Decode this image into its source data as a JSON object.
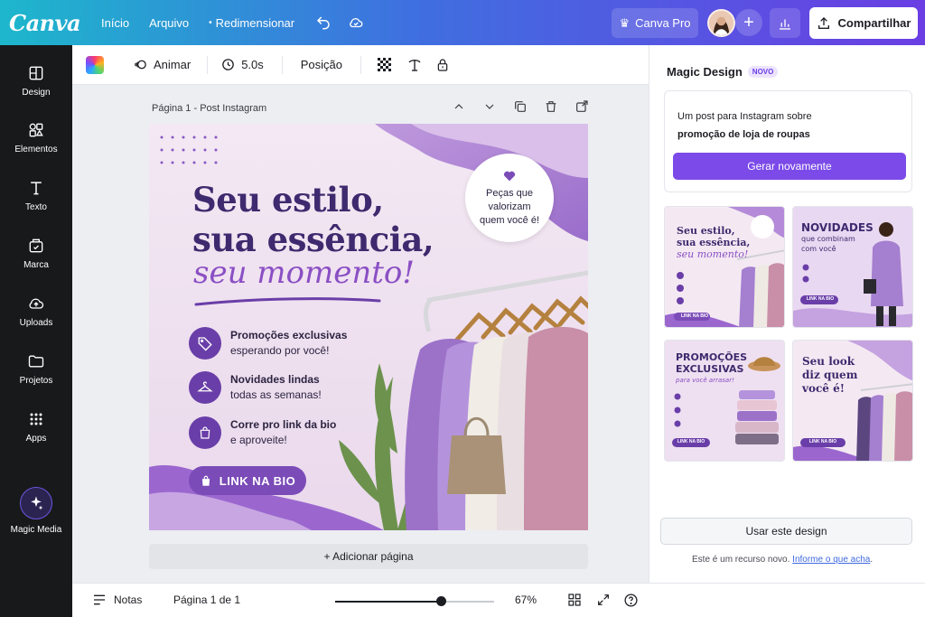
{
  "topbar": {
    "logo": "Canva",
    "nav": [
      "Início",
      "Arquivo"
    ],
    "resize": "Redimensionar",
    "pro": "Canva Pro",
    "share": "Compartilhar"
  },
  "sidebar": {
    "items": [
      "Design",
      "Elementos",
      "Texto",
      "Marca",
      "Uploads",
      "Projetos",
      "Apps"
    ],
    "magic": "Magic Media"
  },
  "toolbar": {
    "animate": "Animar",
    "duration": "5.0s",
    "position": "Posição"
  },
  "canvas": {
    "page_title": "Página 1 - Post Instagram",
    "add_page": "+ Adicionar página"
  },
  "design": {
    "headline_1": "Seu estilo,",
    "headline_2": "sua essência,",
    "script": "seu momento!",
    "bubble": [
      "Peças que",
      "valorizam",
      "quem você é!"
    ],
    "features": [
      {
        "title": "Promoções exclusivas",
        "sub": "esperando por você!"
      },
      {
        "title": "Novidades lindas",
        "sub": "todas as semanas!"
      },
      {
        "title": "Corre pro link da bio",
        "sub": "e aproveite!"
      }
    ],
    "cta": "LINK NA BIO"
  },
  "panel": {
    "title": "Magic Design",
    "badge": "NOVO",
    "prompt_1": "Um post para Instagram sobre",
    "prompt_2": "promoção de loja de roupas",
    "regenerate": "Gerar novamente",
    "thumbs": [
      {
        "line1": "Seu estilo,",
        "line2": "sua essência,",
        "line3": "seu momento!",
        "cta": "LINK NA BIO"
      },
      {
        "line1": "NOVIDADES",
        "line2": "que combinam",
        "line3": "com você",
        "cta": "LINK NA BIO"
      },
      {
        "line1": "PROMOÇÕES",
        "line2": "EXCLUSIVAS",
        "line3": "para você arrasar!",
        "cta": "LINK NA BIO"
      },
      {
        "line1": "Seu look",
        "line2": "diz quem",
        "line3": "você é!",
        "cta": "LINK NA BIO"
      }
    ],
    "use": "Usar este design",
    "feedback": "Este é um recurso novo.",
    "feedback_link": "Informe o que acha"
  },
  "bottom": {
    "notes": "Notas",
    "page_count": "Página 1 de 1",
    "zoom": "67%",
    "zoom_level": 0.67
  },
  "colors": {
    "accent": "#7b4ae8",
    "design_purple": "#6a3ea8",
    "sidebar_bg": "#18191b"
  }
}
